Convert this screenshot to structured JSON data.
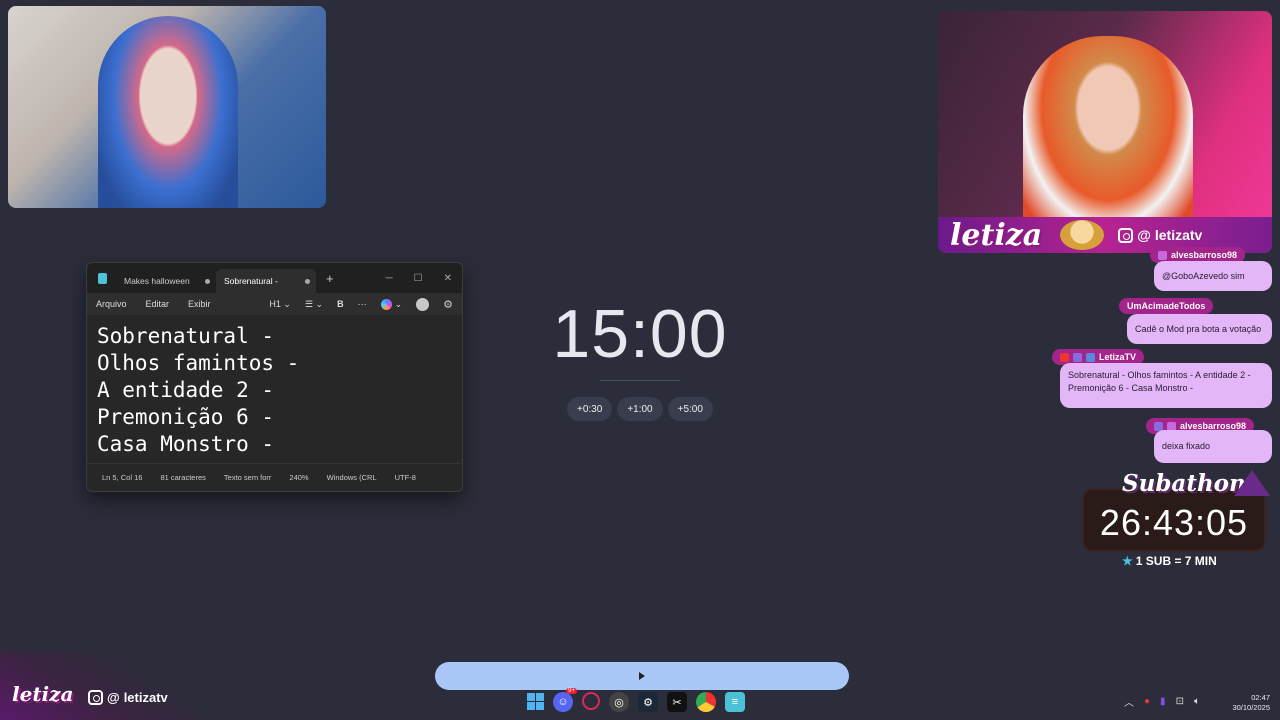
{
  "left_cam": {},
  "right_cam": {
    "brand": "letiza",
    "social": "letizatv"
  },
  "notepad": {
    "tabs": [
      "Makes halloween",
      "Sobrenatural -"
    ],
    "menu": [
      "Arquivo",
      "Editar",
      "Exibir"
    ],
    "heading_select": "H1",
    "bold": "B",
    "more": "···",
    "lines": [
      "Sobrenatural -",
      "Olhos famintos -",
      "A entidade 2 -",
      "Premonição 6 -",
      "Casa Monstro -"
    ],
    "status": [
      "Ln 5, Col 16",
      "81 caracteres",
      "Texto sem forr",
      "240%",
      "Windows (CRL",
      "UTF-8"
    ]
  },
  "timer": {
    "value": "15:00",
    "buttons": [
      "+0:30",
      "+1:00",
      "+5:00"
    ]
  },
  "chat": [
    {
      "user": "alvesbarroso98",
      "text": "@GoboAzevedo sim"
    },
    {
      "user": "UmAcimadeTodos",
      "text": "Cadê o Mod pra bota a votação"
    },
    {
      "user": "LetizaTV",
      "text": "Sobrenatural - Olhos famintos - A entidade 2 - Premonição 6 - Casa Monstro -"
    },
    {
      "user": "alvesbarroso98",
      "text": "deixa fixado"
    }
  ],
  "subathon": {
    "title": "Subathon",
    "clock": "26:43:05",
    "rule": "1 SUB = 7 MIN"
  },
  "bottom_brand": {
    "brand": "letiza",
    "social": "letizatv"
  },
  "taskbar": {
    "discord_badge": "9+",
    "time": "02:47",
    "date": "30/10/2025"
  },
  "colors": {
    "background": "#2b2d3a",
    "chat_bubble": "#e3b6f7",
    "chat_user": "#a3248a",
    "media_bar": "#a9c8f7"
  }
}
